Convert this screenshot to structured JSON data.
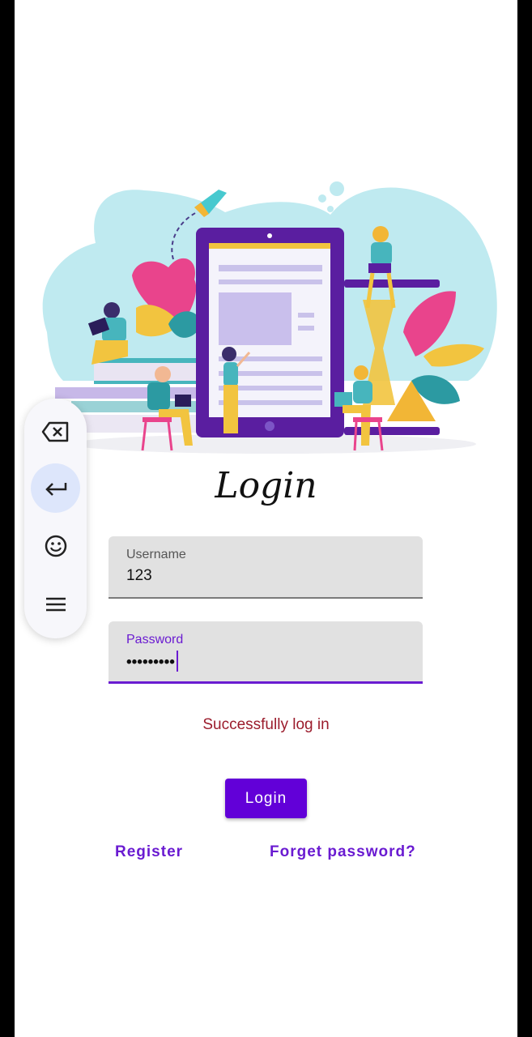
{
  "page": {
    "title": "Login",
    "status_message": "Successfully log in",
    "login_button": "Login",
    "register_link": "Register",
    "forgot_link": "Forget password?"
  },
  "username_field": {
    "label": "Username",
    "value": "123"
  },
  "password_field": {
    "label": "Password",
    "value": "•••••••••"
  },
  "keyboard_toolbar": {
    "items": [
      "backspace-icon",
      "enter-icon",
      "emoji-icon",
      "menu-icon"
    ]
  },
  "colors": {
    "accent": "#6200d8",
    "status": "#9b1c2c",
    "field_bg": "#e1e1e1"
  }
}
